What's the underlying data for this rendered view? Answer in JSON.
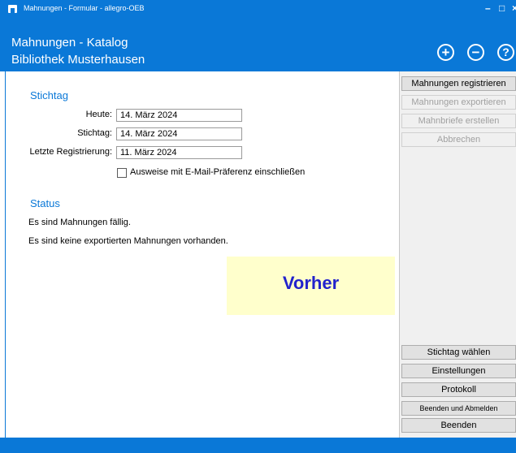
{
  "window": {
    "title": "Mahnungen - Formular - allegro-OEB",
    "min_glyph": "–",
    "max_glyph": "□",
    "close_glyph": "×"
  },
  "header": {
    "line1": "Mahnungen - Katalog",
    "line2": "Bibliothek Musterhausen",
    "icons": [
      "plus-circle-icon",
      "minus-circle-icon",
      "help-circle-icon"
    ],
    "plus_glyph": "+",
    "minus_glyph": "−",
    "help_glyph": "?"
  },
  "stichtag_section": {
    "title": "Stichtag",
    "heute_label": "Heute:",
    "heute_value": "14. März 2024",
    "stichtag_label": "Stichtag:",
    "stichtag_value": "14. März 2024",
    "letzte_label": "Letzte Registrierung:",
    "letzte_value": "11. März 2024",
    "checkbox_label": "Ausweise mit E-Mail-Präferenz einschließen",
    "checkbox_checked": false
  },
  "status_section": {
    "title": "Status",
    "line1": "Es sind Mahnungen fällig.",
    "line2": "Es sind keine exportierten Mahnungen vorhanden."
  },
  "note": {
    "text": "Vorher"
  },
  "actions": {
    "registrieren": "Mahnungen registrieren",
    "exportieren": "Mahnungen exportieren",
    "mahnbriefe": "Mahnbriefe erstellen",
    "abbrechen": "Abbrechen",
    "stichtag_waehlen": "Stichtag wählen",
    "einstellungen": "Einstellungen",
    "protokoll": "Protokoll",
    "beenden_abmelden": "Beenden und Abmelden",
    "beenden": "Beenden"
  },
  "colors": {
    "accent": "#0a78d7",
    "note_bg": "#ffffcc",
    "note_text": "#2222cc"
  }
}
